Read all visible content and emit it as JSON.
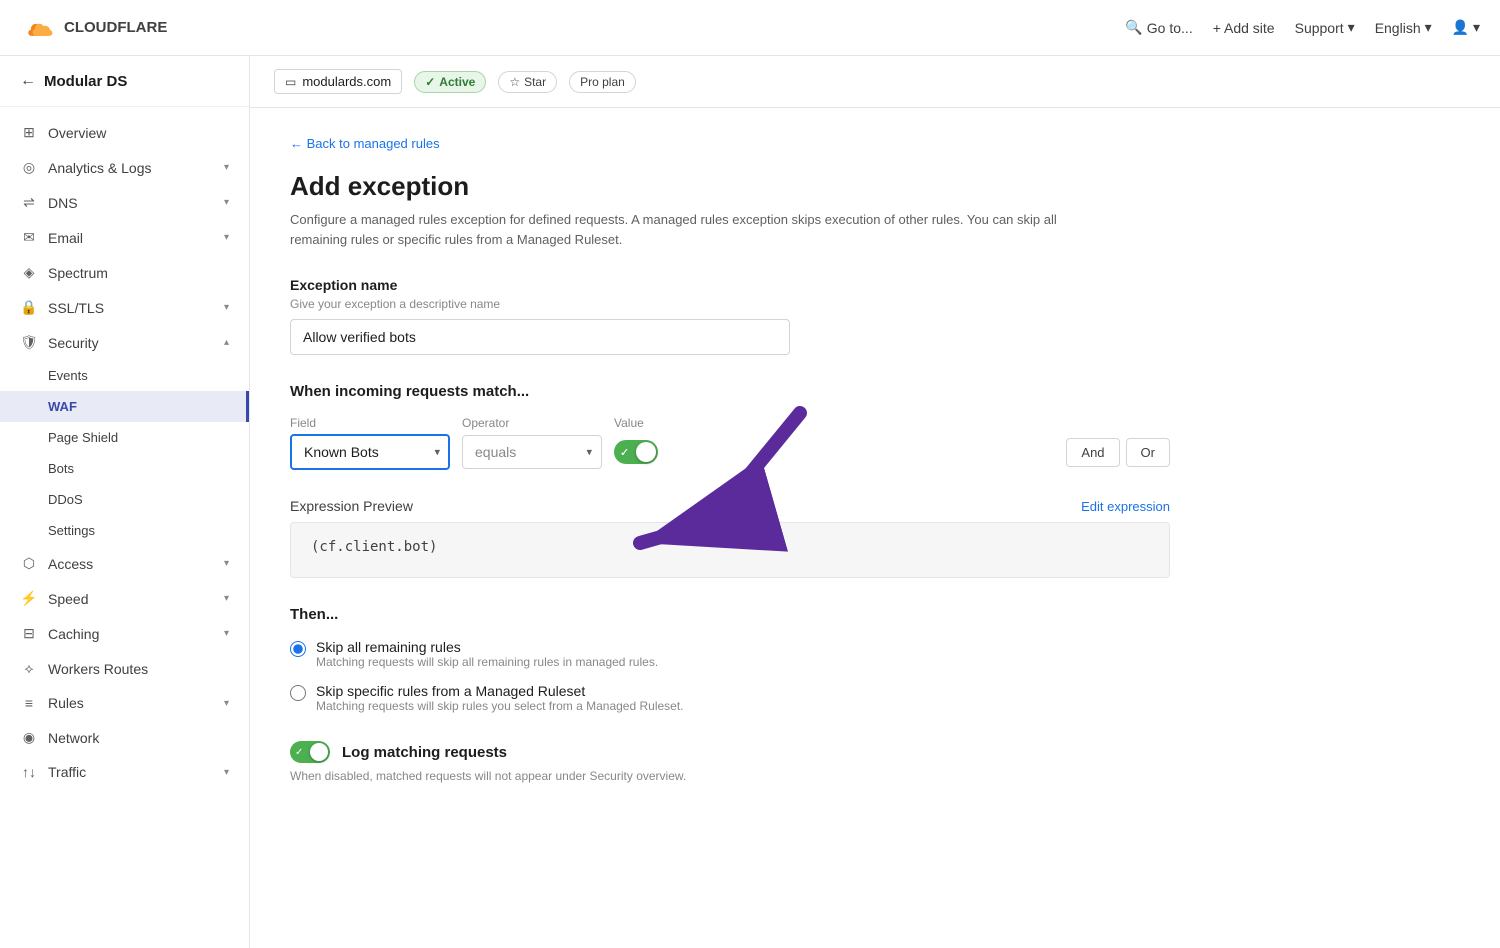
{
  "topNav": {
    "logo_text": "CLOUDFLARE",
    "goto_label": "Go to...",
    "add_site_label": "+ Add site",
    "support_label": "Support",
    "language_label": "English",
    "user_icon": "▾"
  },
  "domainBar": {
    "domain": "modulards.com",
    "active_label": "Active",
    "star_label": "Star",
    "plan_label": "Pro plan"
  },
  "sidebar": {
    "back_label": "← Modular DS",
    "site_title": "Modular DS",
    "nav_items": [
      {
        "label": "Overview",
        "icon": "⊞",
        "sub": false
      },
      {
        "label": "Analytics & Logs",
        "icon": "◎",
        "sub": true,
        "expanded": true
      },
      {
        "label": "DNS",
        "icon": "⇌",
        "sub": true
      },
      {
        "label": "Email",
        "icon": "✉",
        "sub": true
      },
      {
        "label": "Spectrum",
        "icon": "◈",
        "sub": false
      },
      {
        "label": "SSL/TLS",
        "icon": "🔒",
        "sub": true
      },
      {
        "label": "Security",
        "icon": "🛡",
        "sub": true,
        "expanded": true
      },
      {
        "label": "Events",
        "icon": "",
        "sub_item": true
      },
      {
        "label": "WAF",
        "icon": "",
        "sub_item": true,
        "active": true
      },
      {
        "label": "Page Shield",
        "icon": "",
        "sub_item": true
      },
      {
        "label": "Bots",
        "icon": "",
        "sub_item": true
      },
      {
        "label": "DDoS",
        "icon": "",
        "sub_item": true
      },
      {
        "label": "Settings",
        "icon": "",
        "sub_item": true
      },
      {
        "label": "Access",
        "icon": "⬡",
        "sub": true
      },
      {
        "label": "Speed",
        "icon": "⚡",
        "sub": true
      },
      {
        "label": "Caching",
        "icon": "⊟",
        "sub": true
      },
      {
        "label": "Workers Routes",
        "icon": "⟡",
        "sub": false
      },
      {
        "label": "Rules",
        "icon": "≡",
        "sub": true
      },
      {
        "label": "Network",
        "icon": "◉",
        "sub": false
      },
      {
        "label": "Traffic",
        "icon": "↑↓",
        "sub": true
      }
    ]
  },
  "page": {
    "back_link": "← Back to managed rules",
    "title": "Add exception",
    "description": "Configure a managed rules exception for defined requests. A managed rules exception skips execution of other rules. You can skip all remaining rules or specific rules from a Managed Ruleset.",
    "exception_name_label": "Exception name",
    "exception_name_hint": "Give your exception a descriptive name",
    "exception_name_value": "Allow verified bots",
    "when_title": "When incoming requests match...",
    "field_label": "Field",
    "operator_label": "Operator",
    "value_label": "Value",
    "field_value": "Known Bots",
    "operator_value": "equals",
    "expression_label": "Expression Preview",
    "edit_expression_label": "Edit expression",
    "expression_code": "(cf.client.bot)",
    "then_title": "Then...",
    "skip_all_label": "Skip all remaining rules",
    "skip_all_desc": "Matching requests will skip all remaining rules in managed rules.",
    "skip_specific_label": "Skip specific rules from a Managed Ruleset",
    "skip_specific_desc": "Matching requests will skip rules you select from a Managed Ruleset.",
    "log_label": "Log matching requests",
    "log_desc": "When disabled, matched requests will not appear under Security overview.",
    "and_label": "And",
    "or_label": "Or"
  }
}
